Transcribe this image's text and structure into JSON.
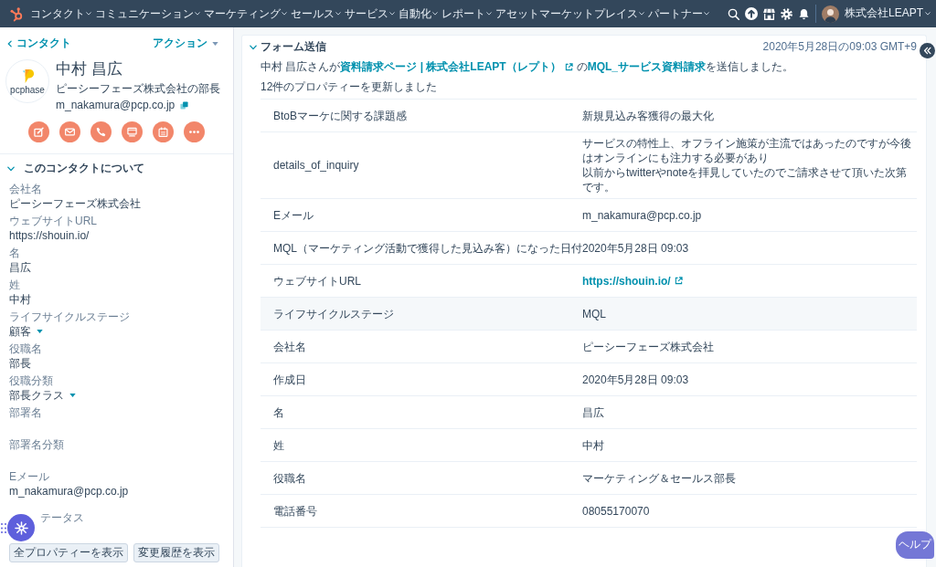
{
  "nav": {
    "menu": [
      "コンタクト",
      "コミュニケーション",
      "マーケティング",
      "セールス",
      "サービス",
      "自動化",
      "レポート",
      "アセットマーケットプレイス",
      "パートナー"
    ],
    "account": "株式会社LEAPT"
  },
  "contact": {
    "back_link": "コンタクト",
    "actions_menu": "アクション",
    "logo_text": "pcphase",
    "name": "中村 昌広",
    "job_title": "ピーシーフェーズ株式会社の部長",
    "email": "m_nakamura@pcp.co.jp"
  },
  "about": {
    "title": "このコンタクトについて",
    "expanded": true,
    "fields": [
      {
        "label": "会社名",
        "kind": "text",
        "value": "ピーシーフェーズ株式会社"
      },
      {
        "label": "ウェブサイトURL",
        "kind": "text",
        "value": "https://shouin.io/"
      },
      {
        "label": "名",
        "kind": "text",
        "value": "昌広"
      },
      {
        "label": "姓",
        "kind": "text",
        "value": "中村"
      },
      {
        "label": "ライフサイクルステージ",
        "kind": "dropdown",
        "value": "顧客"
      },
      {
        "label": "役職名",
        "kind": "text",
        "value": "部長"
      },
      {
        "label": "役職分類",
        "kind": "dropdown",
        "value": "部長クラス"
      },
      {
        "label": "部署名",
        "kind": "text"
      },
      {
        "label": "部署名分類",
        "kind": "text"
      },
      {
        "label": "Eメール",
        "kind": "text",
        "value": "m_nakamura@pcp.co.jp"
      }
    ],
    "last_label": "テータス",
    "buttons": [
      "全プロパティーを表示",
      "変更履歴を表示"
    ]
  },
  "activity": {
    "title": "フォーム送信",
    "expanded": true,
    "timestamp": "2020年5月28日の09:03 GMT+9",
    "sentence": [
      {
        "kind": "text",
        "text": "中村 昌広さんが"
      },
      {
        "kind": "link",
        "text": "資料請求ページ | 株式会社LEAPT（レプト）",
        "external": true
      },
      {
        "kind": "text",
        "text": "の"
      },
      {
        "kind": "link",
        "text": "MQL_サービス資料請求",
        "external": false
      },
      {
        "kind": "text",
        "text": "を送信しました。"
      }
    ],
    "summary": "12件のプロパティーを更新しました",
    "rows": [
      {
        "label": "BtoBマーケに関する課題感",
        "kind": "text",
        "value": "新規見込み客獲得の最大化",
        "highlighted": false
      },
      {
        "label": "details_of_inquiry",
        "kind": "lines",
        "lines": [
          "サービスの特性上、オフライン施策が主流ではあったのですが今後はオンラインにも注力する必要があり",
          "以前からtwitterやnoteを拝見していたのでご請求させて頂いた次第です。"
        ],
        "highlighted": false
      },
      {
        "label": "Eメール",
        "kind": "text",
        "value": "m_nakamura@pcp.co.jp",
        "highlighted": false
      },
      {
        "label": "MQL（マーケティング活動で獲得した見込み客）になった日付",
        "kind": "text",
        "value": "2020年5月28日 09:03",
        "highlighted": false
      },
      {
        "label": "ウェブサイトURL",
        "kind": "link",
        "value": "https://shouin.io/",
        "highlighted": false
      },
      {
        "label": "ライフサイクルステージ",
        "kind": "text",
        "value": "MQL",
        "highlighted": true
      },
      {
        "label": "会社名",
        "kind": "text",
        "value": "ピーシーフェーズ株式会社",
        "highlighted": false
      },
      {
        "label": "作成日",
        "kind": "text",
        "value": "2020年5月28日 09:03",
        "highlighted": false
      },
      {
        "label": "名",
        "kind": "text",
        "value": "昌広",
        "highlighted": false
      },
      {
        "label": "姓",
        "kind": "text",
        "value": "中村",
        "highlighted": false
      },
      {
        "label": "役職名",
        "kind": "text",
        "value": "マーケティング＆セールス部長",
        "highlighted": false
      },
      {
        "label": "電話番号",
        "kind": "text",
        "value": "08055170070",
        "highlighted": false
      }
    ]
  },
  "help_button": "ヘルプ"
}
